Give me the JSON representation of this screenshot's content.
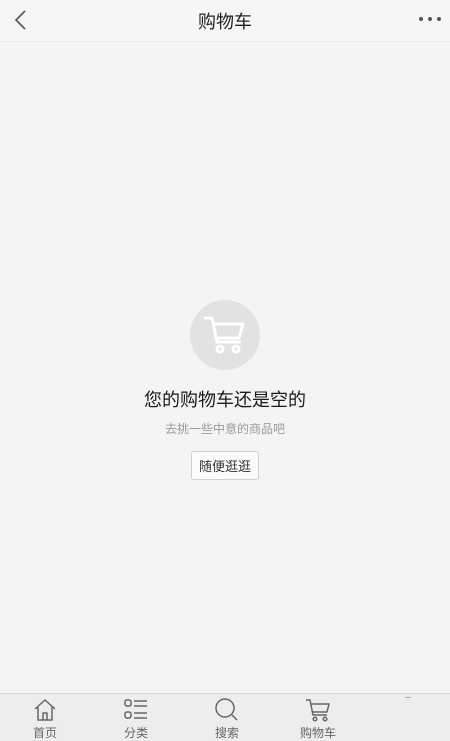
{
  "header": {
    "title": "购物车",
    "back_icon": "chevron-left-icon",
    "more_icon": "more-dots-icon"
  },
  "empty_state": {
    "icon": "cart-icon",
    "title": "您的购物车还是空的",
    "subtitle": "去挑一些中意的商品吧",
    "button_label": "随便逛逛"
  },
  "tabbar": {
    "items": [
      {
        "label": "首页",
        "icon": "home-icon"
      },
      {
        "label": "分类",
        "icon": "category-list-icon"
      },
      {
        "label": "搜索",
        "icon": "search-icon"
      },
      {
        "label": "购物车",
        "icon": "cart-icon"
      }
    ]
  },
  "colors": {
    "background": "#f4f4f4",
    "icon_circle": "#e2e2e2",
    "tabbar_bg": "#ededed"
  }
}
